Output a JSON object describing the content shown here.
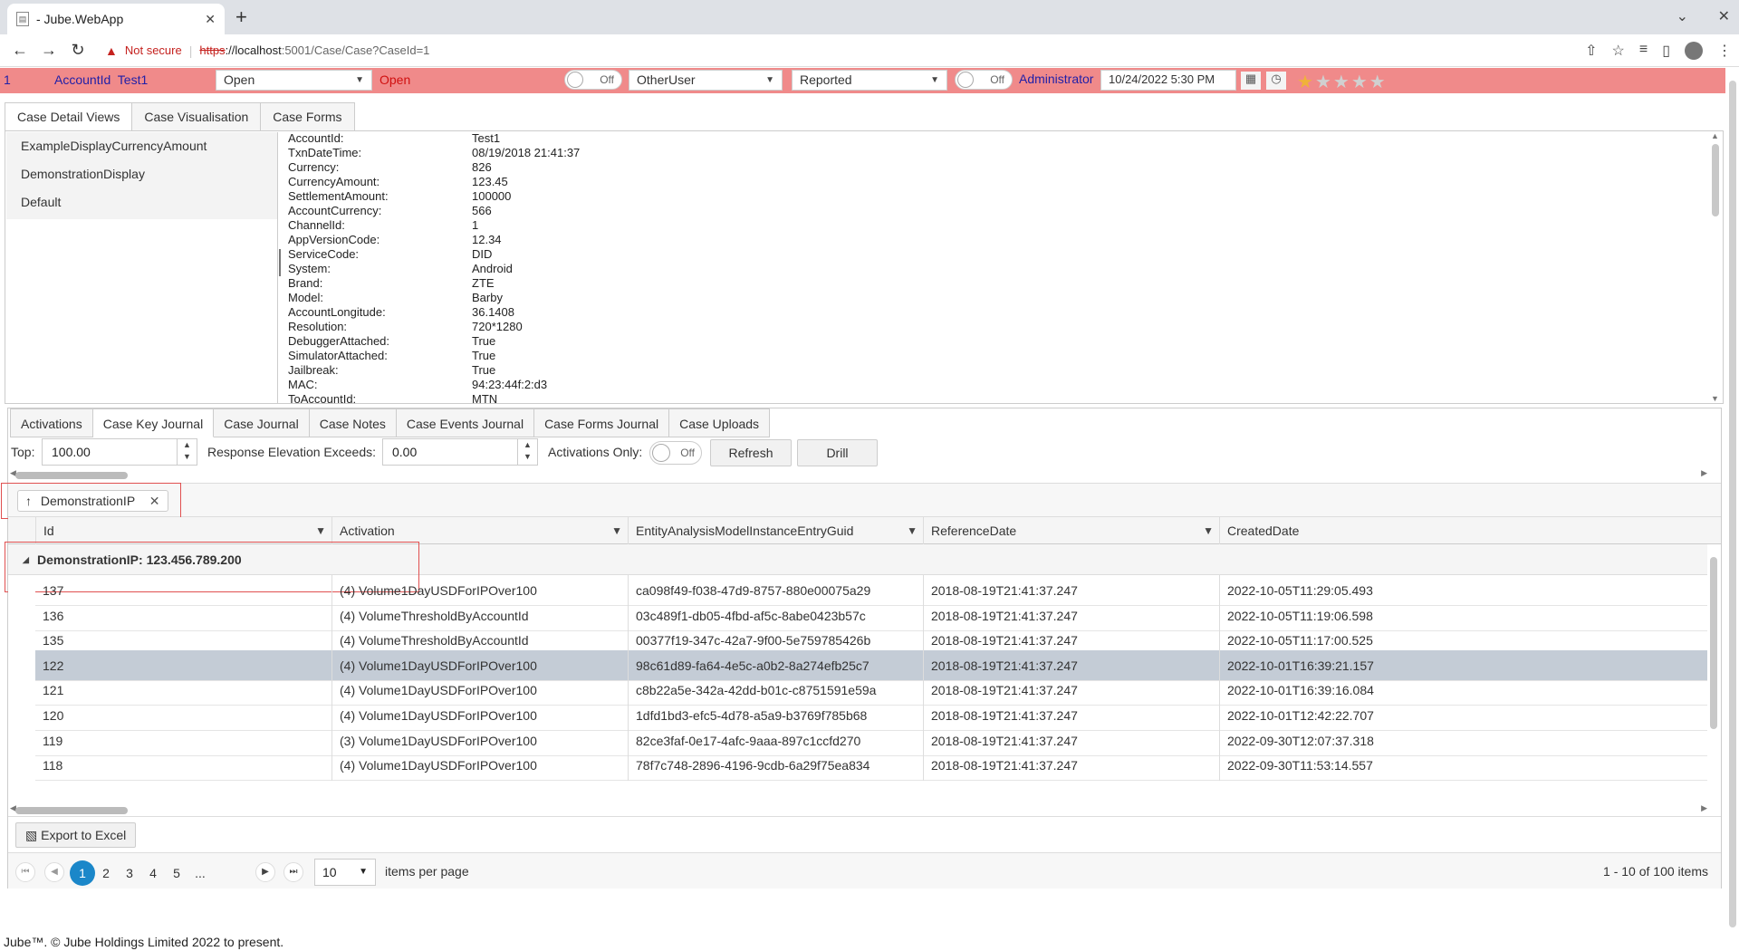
{
  "browser": {
    "tab_title": " - Jube.WebApp",
    "security_label": "Not secure",
    "url_scheme": "https",
    "url_host": "://localhost",
    "url_path": ":5001/Case/Case?CaseId=1"
  },
  "casebar": {
    "case_id": "1",
    "account_label": "AccountId  Test1",
    "status_select": "Open",
    "status_text": "Open",
    "switch1": "Off",
    "user_select": "OtherUser",
    "workflow_select": "Reported",
    "switch2": "Off",
    "admin": "Administrator",
    "date": "10/24/2022 5:30 PM",
    "rating": 1,
    "rating_max": 5,
    "colors": {
      "bar": "#f08a8a",
      "text": "#1f1fa8",
      "status": "#d01010"
    }
  },
  "top_tabs": [
    "Case Detail Views",
    "Case Visualisation",
    "Case Forms"
  ],
  "views": [
    "ExampleDisplayCurrencyAmount",
    "DemonstrationDisplay",
    "Default"
  ],
  "details": [
    {
      "k": "AccountId:",
      "v": "Test1"
    },
    {
      "k": "TxnDateTime:",
      "v": "08/19/2018 21:41:37"
    },
    {
      "k": "Currency:",
      "v": "826"
    },
    {
      "k": "CurrencyAmount:",
      "v": "123.45"
    },
    {
      "k": "SettlementAmount:",
      "v": "100000"
    },
    {
      "k": "AccountCurrency:",
      "v": "566"
    },
    {
      "k": "ChannelId:",
      "v": "1"
    },
    {
      "k": "AppVersionCode:",
      "v": "12.34"
    },
    {
      "k": "ServiceCode:",
      "v": "DID"
    },
    {
      "k": "System:",
      "v": "Android"
    },
    {
      "k": "Brand:",
      "v": "ZTE"
    },
    {
      "k": "Model:",
      "v": "Barby"
    },
    {
      "k": "AccountLongitude:",
      "v": "36.1408"
    },
    {
      "k": "Resolution:",
      "v": "720*1280"
    },
    {
      "k": "DebuggerAttached:",
      "v": "True"
    },
    {
      "k": "SimulatorAttached:",
      "v": "True"
    },
    {
      "k": "Jailbreak:",
      "v": "True"
    },
    {
      "k": "MAC:",
      "v": "94:23:44f:2:d3"
    },
    {
      "k": "ToAccountId:",
      "v": "MTN"
    }
  ],
  "lower_tabs": [
    "Activations",
    "Case Key Journal",
    "Case Journal",
    "Case Notes",
    "Case Events Journal",
    "Case Forms Journal",
    "Case Uploads"
  ],
  "toolbar": {
    "top_label": "Top:",
    "top_value": "100.00",
    "elevation_label": "Response Elevation Exceeds:",
    "elevation_value": "0.00",
    "activations_label": "Activations Only:",
    "activations_switch": "Off",
    "refresh": "Refresh",
    "drill": "Drill"
  },
  "group_chip": "DemonstrationIP",
  "columns": [
    "Id",
    "Activation",
    "EntityAnalysisModelInstanceEntryGuid",
    "ReferenceDate",
    "CreatedDate"
  ],
  "group_row": "DemonstrationIP: 123.456.789.200",
  "rows": [
    [
      "137",
      "(4) Volume1DayUSDForIPOver100",
      "ca098f49-f038-47d9-8757-880e00075a29",
      "2018-08-19T21:41:37.247",
      "2022-10-05T11:29:05.493"
    ],
    [
      "136",
      "(4) VolumeThresholdByAccountId",
      "03c489f1-db05-4fbd-af5c-8abe0423b57c",
      "2018-08-19T21:41:37.247",
      "2022-10-05T11:19:06.598"
    ],
    [
      "135",
      "(4) VolumeThresholdByAccountId",
      "00377f19-347c-42a7-9f00-5e759785426b",
      "2018-08-19T21:41:37.247",
      "2022-10-05T11:17:00.525"
    ],
    [
      "122",
      "(4) Volume1DayUSDForIPOver100",
      "98c61d89-fa64-4e5c-a0b2-8a274efb25c7",
      "2018-08-19T21:41:37.247",
      "2022-10-01T16:39:21.157"
    ],
    [
      "121",
      "(4) Volume1DayUSDForIPOver100",
      "c8b22a5e-342a-42dd-b01c-c8751591e59a",
      "2018-08-19T21:41:37.247",
      "2022-10-01T16:39:16.084"
    ],
    [
      "120",
      "(4) Volume1DayUSDForIPOver100",
      "1dfd1bd3-efc5-4d78-a5a9-b3769f785b68",
      "2018-08-19T21:41:37.247",
      "2022-10-01T12:42:22.707"
    ],
    [
      "119",
      "(3) Volume1DayUSDForIPOver100",
      "82ce3faf-0e17-4afc-9aaa-897c1ccfd270",
      "2018-08-19T21:41:37.247",
      "2022-09-30T12:07:37.318"
    ],
    [
      "118",
      "(4) Volume1DayUSDForIPOver100",
      "78f7c748-2896-4196-9cdb-6a29f75ea834",
      "2018-08-19T21:41:37.247",
      "2022-09-30T11:53:14.557"
    ]
  ],
  "selected_row": 3,
  "export_label": "Export to Excel",
  "pager": {
    "pages": [
      "1",
      "2",
      "3",
      "4",
      "5",
      "..."
    ],
    "current": "1",
    "page_size": "10",
    "items_label": "items per page",
    "info": "1 - 10 of 100 items"
  },
  "footer": "Jube™. © Jube Holdings Limited 2022 to present."
}
